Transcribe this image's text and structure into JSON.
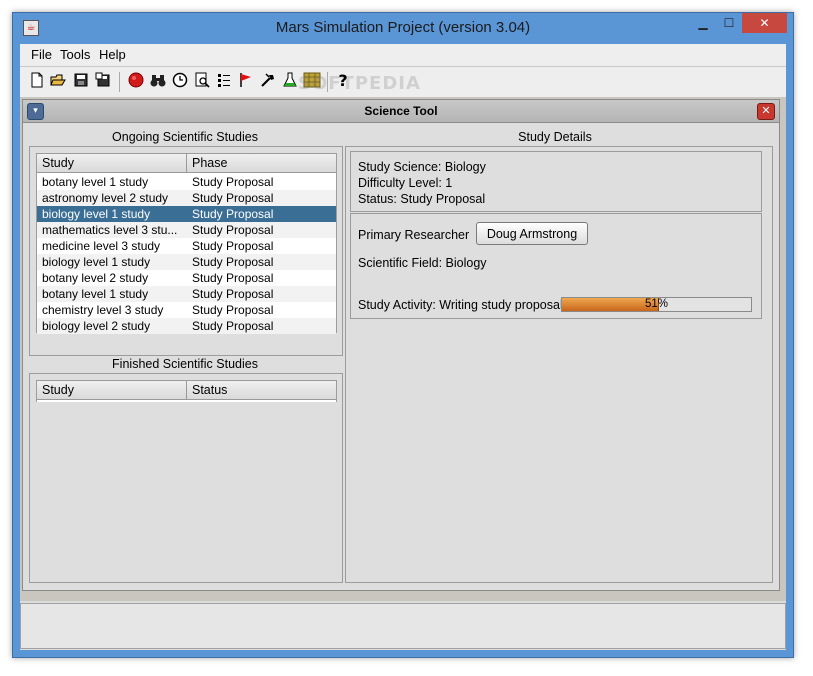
{
  "window": {
    "title": "Mars Simulation Project (version 3.04)",
    "minimize_glyph": "▁",
    "maximize_glyph": "☐",
    "close_glyph": "✕"
  },
  "menu": [
    "File",
    "Tools",
    "Help"
  ],
  "toolbar": {
    "icons": [
      "new-icon",
      "open-icon",
      "save-icon",
      "save-as-icon",
      "mars-icon",
      "binoculars-icon",
      "clock-icon",
      "search-icon",
      "list-icon",
      "flag-icon",
      "wrench-icon",
      "flask-icon",
      "map-icon",
      "help-icon"
    ],
    "help_glyph": "?",
    "watermark": "SOFTPEDIA"
  },
  "science_tool": {
    "title": "Science Tool",
    "menu_glyph": "▾",
    "close_glyph": "✕",
    "ongoing": {
      "title": "Ongoing Scientific Studies",
      "columns": [
        "Study",
        "Phase"
      ],
      "rows": [
        {
          "study": "botany level 1 study",
          "phase": "Study Proposal"
        },
        {
          "study": "astronomy level 2 study",
          "phase": "Study Proposal"
        },
        {
          "study": "biology level 1 study",
          "phase": "Study Proposal"
        },
        {
          "study": "mathematics level 3 stu...",
          "phase": "Study Proposal"
        },
        {
          "study": "medicine level 3 study",
          "phase": "Study Proposal"
        },
        {
          "study": "biology level 1 study",
          "phase": "Study Proposal"
        },
        {
          "study": "botany level 2 study",
          "phase": "Study Proposal"
        },
        {
          "study": "botany level 1 study",
          "phase": "Study Proposal"
        },
        {
          "study": "chemistry level 3 study",
          "phase": "Study Proposal"
        },
        {
          "study": "biology level 2 study",
          "phase": "Study Proposal"
        }
      ],
      "selected_index": 2
    },
    "finished": {
      "title": "Finished Scientific Studies",
      "columns": [
        "Study",
        "Status"
      ]
    },
    "details": {
      "title": "Study Details",
      "science": "Study Science: Biology",
      "difficulty": "Difficulty Level: 1",
      "status": "Status: Study Proposal",
      "researcher_label": "Primary Researcher",
      "researcher_name": "Doug Armstrong",
      "field": "Scientific Field: Biology",
      "activity": "Study Activity: Writing study proposal",
      "progress_percent": 51,
      "progress_label": "51%"
    }
  }
}
